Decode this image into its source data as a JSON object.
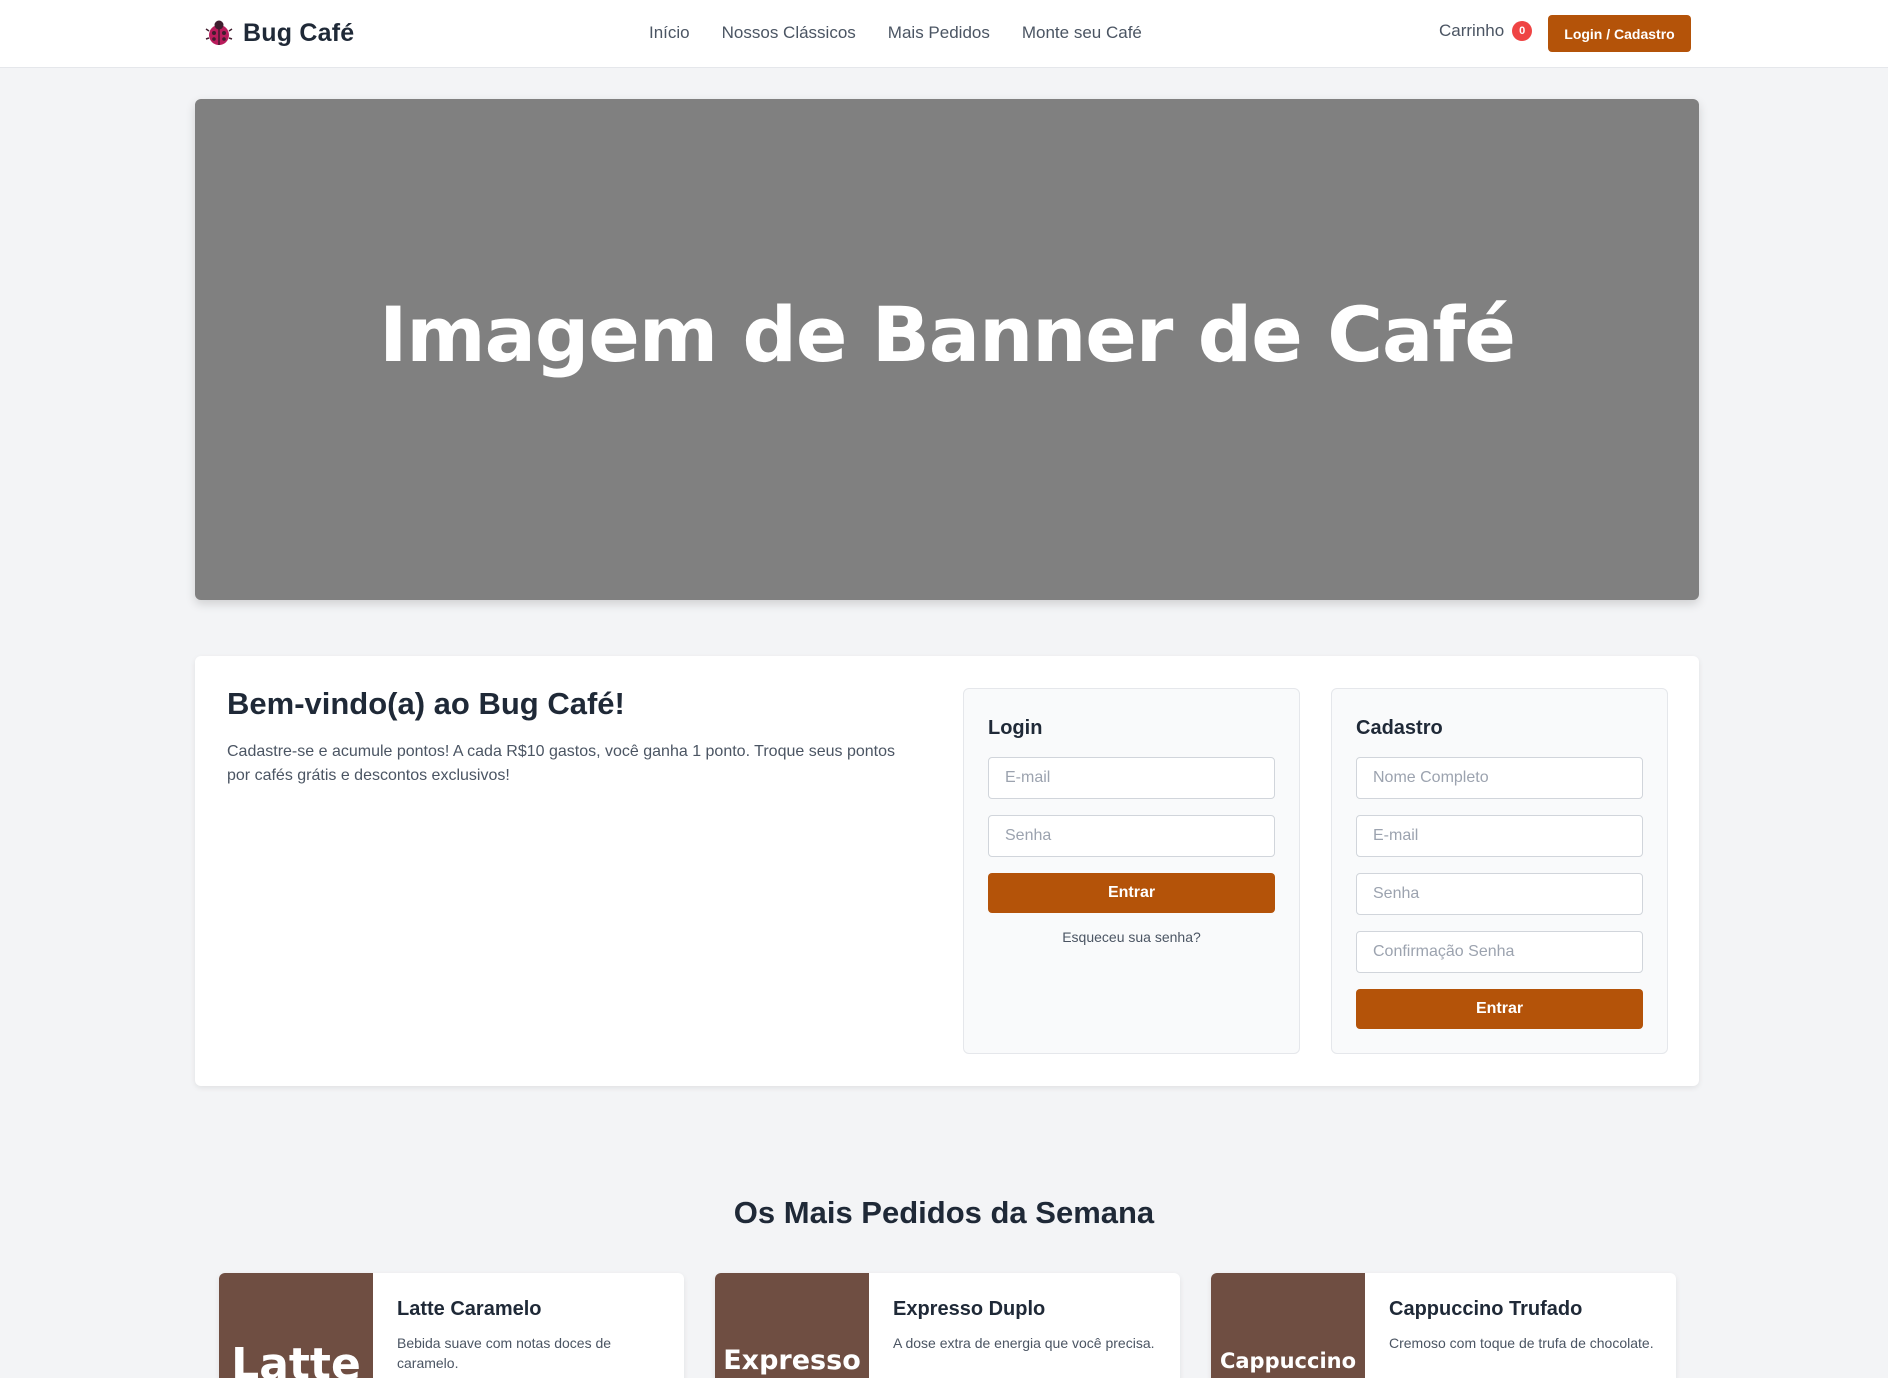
{
  "navbar": {
    "brand": "Bug Café",
    "links": [
      "Início",
      "Nossos Clássicos",
      "Mais Pedidos",
      "Monte seu Café"
    ],
    "cart_label": "Carrinho",
    "cart_count": "0",
    "login_button": "Login / Cadastro",
    "icons": {
      "logo": "ladybug-icon"
    }
  },
  "hero": {
    "text": "Imagem de Banner de Café"
  },
  "welcome": {
    "title": "Bem-vindo(a) ao Bug Café!",
    "description": "Cadastre-se e acumule pontos! A cada R$10 gastos, você ganha 1 ponto. Troque seus pontos por cafés grátis e descontos exclusivos!"
  },
  "login_form": {
    "title": "Login",
    "email_placeholder": "E-mail",
    "password_placeholder": "Senha",
    "submit": "Entrar",
    "forgot": "Esqueceu sua senha?"
  },
  "signup_form": {
    "title": "Cadastro",
    "name_placeholder": "Nome Completo",
    "email_placeholder": "E-mail",
    "password_placeholder": "Senha",
    "confirm_placeholder": "Confirmação Senha",
    "submit": "Entrar"
  },
  "popular": {
    "title": "Os Mais Pedidos da Semana",
    "products": [
      {
        "thumb": "Latte",
        "name": "Latte Caramelo",
        "description": "Bebida suave com notas doces de caramelo."
      },
      {
        "thumb": "Expresso",
        "name": "Expresso Duplo",
        "description": "A dose extra de energia que você precisa."
      },
      {
        "thumb": "Cappuccino",
        "name": "Cappuccino Trufado",
        "description": "Cremoso com toque de trufa de chocolate."
      }
    ]
  },
  "colors": {
    "accent": "#b45309",
    "badge": "#ef4444",
    "hero_bg": "#808080",
    "thumb_bg": "#6f4e42",
    "page_bg": "#f3f4f6"
  }
}
